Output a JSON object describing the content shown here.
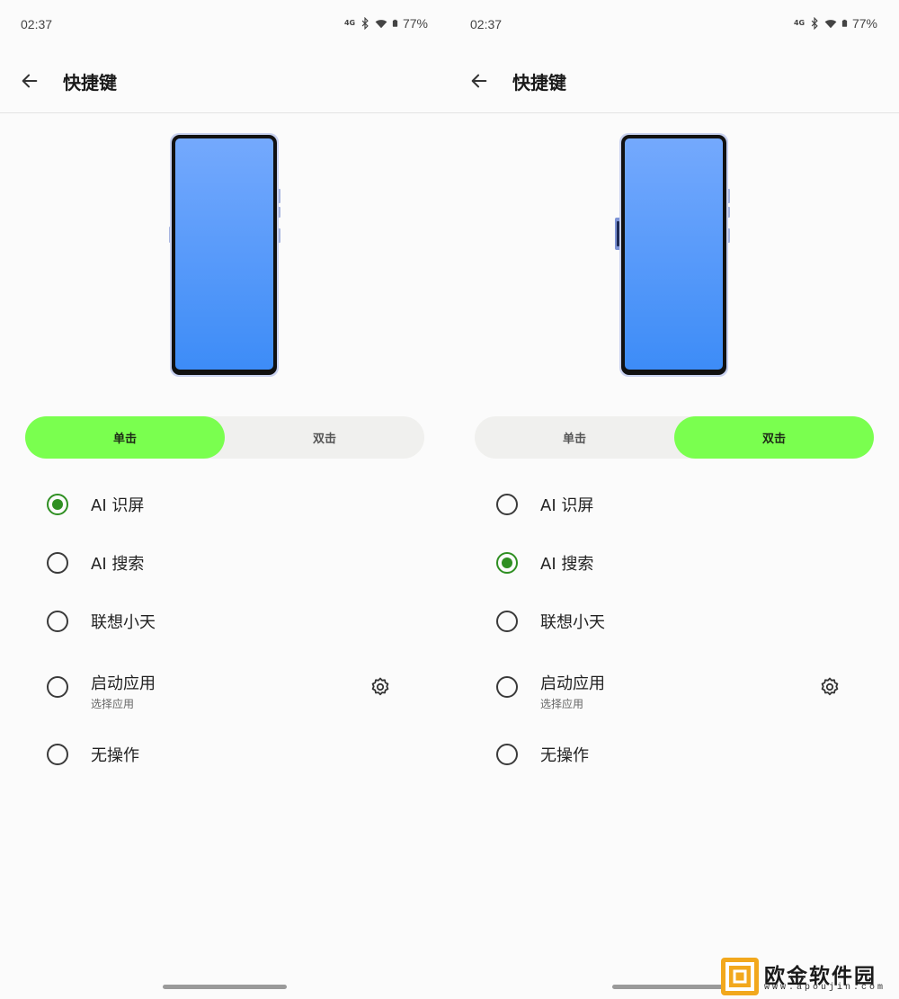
{
  "status": {
    "time": "02:37",
    "battery": "77%",
    "network_badge": "4G"
  },
  "icons": {
    "back": "arrow-left-icon",
    "gear": "gear-icon",
    "bluetooth": "bluetooth-icon",
    "wifi": "wifi-icon",
    "battery": "battery-icon"
  },
  "app_bar": {
    "title": "快捷键"
  },
  "segment": {
    "single": "单击",
    "double": "双击"
  },
  "options": [
    {
      "label": "AI 识屏"
    },
    {
      "label": "AI 搜索"
    },
    {
      "label": "联想小天"
    },
    {
      "label": "启动应用",
      "sub": "选择应用"
    },
    {
      "label": "无操作"
    }
  ],
  "panels": [
    {
      "active_segment": "single",
      "selected_option": "AI 识屏"
    },
    {
      "active_segment": "double",
      "selected_option": "AI 搜索"
    }
  ],
  "colors": {
    "accent_green": "#7aff4f",
    "radio_selected": "#2f8f22",
    "phone_screen_top": "#74a9fd",
    "phone_screen_bottom": "#3d8cf7"
  },
  "watermark": {
    "name": "欧金软件园",
    "url": "www.apoujin.com"
  }
}
